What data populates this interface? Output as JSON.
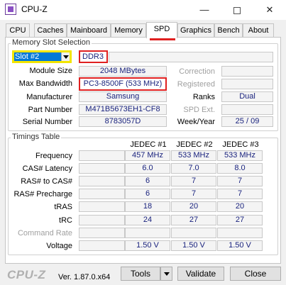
{
  "window": {
    "title": "CPU-Z",
    "minimize": "—",
    "close": "✕"
  },
  "tabs": [
    "CPU",
    "Caches",
    "Mainboard",
    "Memory",
    "SPD",
    "Graphics",
    "Bench",
    "About"
  ],
  "memory_slot": {
    "group_label": "Memory Slot Selection",
    "slot_value": "Slot #2",
    "type": "DDR3",
    "module_size_label": "Module Size",
    "module_size": "2048 MBytes",
    "max_bandwidth_label": "Max Bandwidth",
    "max_bandwidth": "PC3-8500F (533 MHz)",
    "manufacturer_label": "Manufacturer",
    "manufacturer": "Samsung",
    "part_number_label": "Part Number",
    "part_number": "M471B5673EH1-CF8",
    "serial_number_label": "Serial Number",
    "serial_number": "8783057D",
    "correction_label": "Correction",
    "registered_label": "Registered",
    "ranks_label": "Ranks",
    "ranks": "Dual",
    "spd_ext_label": "SPD Ext.",
    "week_year_label": "Week/Year",
    "week_year": "25 / 09"
  },
  "timings": {
    "group_label": "Timings Table",
    "columns": [
      "JEDEC #1",
      "JEDEC #2",
      "JEDEC #3"
    ],
    "rows": [
      {
        "label": "Frequency",
        "values": [
          "457 MHz",
          "533 MHz",
          "533 MHz"
        ]
      },
      {
        "label": "CAS# Latency",
        "values": [
          "6.0",
          "7.0",
          "8.0"
        ]
      },
      {
        "label": "RAS# to CAS#",
        "values": [
          "6",
          "7",
          "7"
        ]
      },
      {
        "label": "RAS# Precharge",
        "values": [
          "6",
          "7",
          "7"
        ]
      },
      {
        "label": "tRAS",
        "values": [
          "18",
          "20",
          "20"
        ]
      },
      {
        "label": "tRC",
        "values": [
          "24",
          "27",
          "27"
        ]
      },
      {
        "label": "Command Rate",
        "values": [
          "",
          "",
          ""
        ]
      },
      {
        "label": "Voltage",
        "values": [
          "1.50 V",
          "1.50 V",
          "1.50 V"
        ]
      }
    ]
  },
  "footer": {
    "logo": "CPU-Z",
    "version": "Ver. 1.87.0.x64",
    "tools": "Tools",
    "validate": "Validate",
    "close": "Close"
  },
  "colors": {
    "accent": "#0078d7",
    "highlight_red": "#e02020",
    "highlight_yellow": "#f2e500",
    "value_text": "#1a237e"
  }
}
